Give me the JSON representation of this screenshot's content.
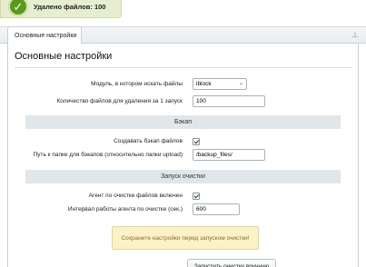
{
  "notice": {
    "text": "Удалено файлов: 100"
  },
  "tabs": [
    {
      "label": "Основные настройки"
    }
  ],
  "panel": {
    "title": "Основные настройки"
  },
  "fields": {
    "module": {
      "label": "Модуль, в котором искать файлы",
      "value": "iblock"
    },
    "batch": {
      "label": "Количество файлов для удаления за 1 запуск",
      "value": "100"
    }
  },
  "backup": {
    "heading": "Бэкап",
    "create": {
      "label": "Создавать бэкап файлов",
      "checked": true
    },
    "path": {
      "label": "Путь к папке для бэкапов (относительно папки upload)",
      "value": "/backup_files/"
    }
  },
  "cleanup": {
    "heading": "Запуск очистки",
    "agent": {
      "label": "Агент по очистке файлов включен",
      "checked": true
    },
    "interval": {
      "label": "Интервал работы агента по очистке (сек.)",
      "value": "600"
    }
  },
  "warning": {
    "text": "Сохраните настройки перед запуском очистки!"
  },
  "actions": {
    "run_label": "Запустить очистку вручную"
  },
  "colors": {
    "success": "#5a9a1a",
    "notice_bg": "#e7eecf",
    "warning_bg": "#fbf3c7",
    "warning_text": "#8d6a2b",
    "section_bg": "#e0e6ea"
  }
}
